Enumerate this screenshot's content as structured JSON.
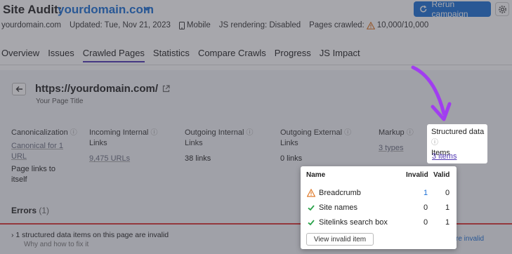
{
  "header": {
    "title_prefix": "Site Audit:",
    "domain": "yourdomain.com",
    "rerun_label": "Rerun campaign"
  },
  "meta": {
    "domain": "yourdomain.com",
    "updated": "Updated: Tue, Nov 21, 2023",
    "device": "Mobile",
    "js_rendering": "JS rendering: Disabled",
    "pages_crawled_label": "Pages crawled:",
    "pages_crawled_value": "10,000/10,000"
  },
  "tabs": [
    {
      "label": "Overview",
      "active": false
    },
    {
      "label": "Issues",
      "active": false
    },
    {
      "label": "Crawled Pages",
      "active": true
    },
    {
      "label": "Statistics",
      "active": false
    },
    {
      "label": "Compare Crawls",
      "active": false
    },
    {
      "label": "Progress",
      "active": false
    },
    {
      "label": "JS Impact",
      "active": false
    }
  ],
  "page": {
    "url": "https://yourdomain.com/",
    "title": "Your Page Title"
  },
  "metrics": {
    "canonicalization": {
      "label_1": "Canonicalization",
      "val_1": "Canonical for 1",
      "val_2": "URL",
      "extra_1": "Page links to",
      "extra_2": "itself"
    },
    "incoming": {
      "label_1": "Incoming Internal",
      "label_2": "Links",
      "val": "9,475 URLs"
    },
    "outgoing_int": {
      "label_1": "Outgoing Internal",
      "label_2": "Links",
      "val": "38 links"
    },
    "outgoing_ext": {
      "label_1": "Outgoing External",
      "label_2": "Links",
      "val": "0 links"
    },
    "markup": {
      "label_1": "Markup",
      "val": "3 types"
    },
    "structured": {
      "label_1": "Structured data",
      "label_2": "Items",
      "val": "3 items"
    }
  },
  "errors": {
    "title": "Errors",
    "count": "(1)",
    "row": "1 structured data items on this page are invalid",
    "sub": "Why and how to fix it",
    "link": "re invalid"
  },
  "popup": {
    "col_name": "Name",
    "col_invalid": "Invalid",
    "col_valid": "Valid",
    "rows": [
      {
        "name": "Breadcrumb",
        "invalid": "1",
        "valid": "0",
        "status": "warning"
      },
      {
        "name": "Site names",
        "invalid": "0",
        "valid": "1",
        "status": "ok"
      },
      {
        "name": "Sitelinks search box",
        "invalid": "0",
        "valid": "1",
        "status": "ok"
      }
    ],
    "view_button": "View invalid item"
  },
  "colors": {
    "brand_blue": "#1a6fd6",
    "accent_purple": "#4e35b2",
    "error_red": "#d33",
    "ok_green": "#2aa24a",
    "warning_orange": "#e07b2a"
  }
}
